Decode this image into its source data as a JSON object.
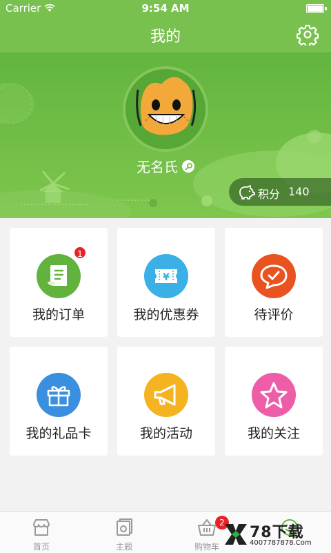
{
  "status": {
    "carrier": "Carrier",
    "time": "9:54 AM"
  },
  "header": {
    "title": "我的"
  },
  "profile": {
    "username": "无名氏",
    "points_label": "积分",
    "points_value": "140"
  },
  "menu": [
    {
      "label": "我的订单",
      "icon": "receipt-icon",
      "color": "#62b33d",
      "badge": "1"
    },
    {
      "label": "我的优惠券",
      "icon": "coupon-icon",
      "color": "#3ab0e6"
    },
    {
      "label": "待评价",
      "icon": "chat-check-icon",
      "color": "#e8531f"
    },
    {
      "label": "我的礼品卡",
      "icon": "gift-icon",
      "color": "#3a8fde"
    },
    {
      "label": "我的活动",
      "icon": "megaphone-icon",
      "color": "#f6b321"
    },
    {
      "label": "我的关注",
      "icon": "star-icon",
      "color": "#ee5da8"
    }
  ],
  "tabbar": {
    "tabs": [
      {
        "label": "首页",
        "icon": "store-icon"
      },
      {
        "label": "主题",
        "icon": "theme-icon"
      },
      {
        "label": "购物车",
        "icon": "basket-icon",
        "badge": "2"
      },
      {
        "label": "",
        "icon": "smile-icon"
      }
    ]
  },
  "watermark": {
    "brand": "78下载",
    "site": "4007787878.Com"
  },
  "colors": {
    "brand_green": "#79c14e",
    "badge_red": "#e82227"
  }
}
